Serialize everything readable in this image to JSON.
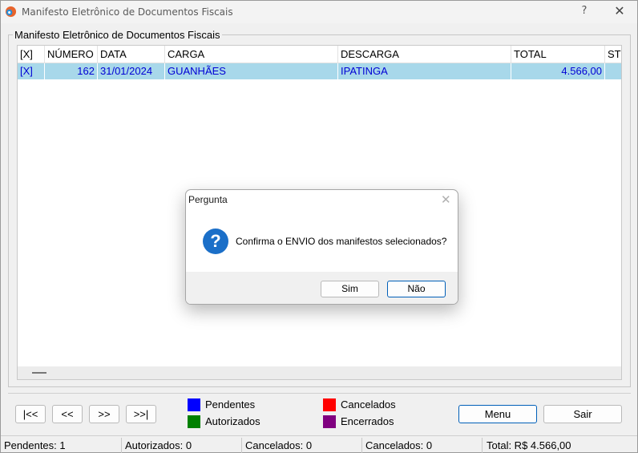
{
  "window": {
    "title": "Manifesto Eletrônico de Documentos Fiscais",
    "help": "?",
    "close": "✕"
  },
  "group": {
    "label": "Manifesto Eletrônico de Documentos Fiscais"
  },
  "grid": {
    "columns": [
      "[X]",
      "NÚMERO",
      "DATA",
      "CARGA",
      "DESCARGA",
      "TOTAL",
      "ST"
    ],
    "rows": [
      [
        "[X]",
        "162",
        "31/01/2024",
        "GUANHÃES",
        "IPATINGA",
        "4.566,00",
        ""
      ]
    ]
  },
  "nav": {
    "first": "|<<",
    "prev": "<<",
    "next": ">>",
    "last": ">>|"
  },
  "legend": [
    {
      "label": "Pendentes",
      "color": "#0000ff"
    },
    {
      "label": "Cancelados",
      "color": "#ff0000"
    },
    {
      "label": "Autorizados",
      "color": "#008000"
    },
    {
      "label": "Encerrados",
      "color": "#800080"
    }
  ],
  "actions": {
    "menu": "Menu",
    "exit": "Sair"
  },
  "status": {
    "pending": "Pendentes: 1",
    "authorized": "Autorizados: 0",
    "cancelled_1": "Cancelados: 0",
    "cancelled_2": "Cancelados: 0",
    "total": "Total: R$ 4.566,00"
  },
  "dialog": {
    "title": "Pergunta",
    "close": "✕",
    "icon": "question-icon",
    "message": "Confirma o ENVIO dos manifestos selecionados?",
    "yes": "Sim",
    "no": "Não"
  }
}
